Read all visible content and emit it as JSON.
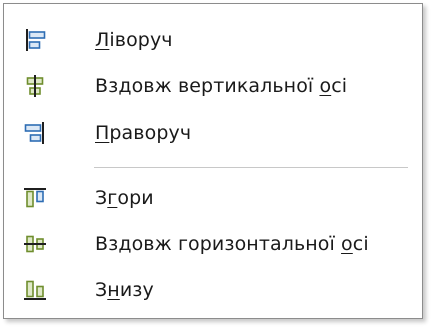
{
  "menu": {
    "items": [
      {
        "icon": "align-left-icon",
        "pre": "",
        "u": "Л",
        "post": "іворуч"
      },
      {
        "icon": "align-center-vertical-axis-icon",
        "pre": "Вздовж вертикальної ",
        "u": "о",
        "post": "сі"
      },
      {
        "icon": "align-right-icon",
        "pre": "",
        "u": "П",
        "post": "раворуч"
      },
      {
        "icon": "align-top-icon",
        "pre": "З",
        "u": "г",
        "post": "ори"
      },
      {
        "icon": "align-center-horizontal-axis-icon",
        "pre": "Вздовж горизонтальної ",
        "u": "о",
        "post": "сі"
      },
      {
        "icon": "align-bottom-icon",
        "pre": "З",
        "u": "н",
        "post": "изу"
      }
    ]
  },
  "colors": {
    "icon_dark": "#1f1f1f",
    "icon_blue": "#2e6db4",
    "icon_fill": "#dbe8f6",
    "icon_green": "#6f8e2e",
    "icon_green_fill": "#dfe9c8"
  }
}
